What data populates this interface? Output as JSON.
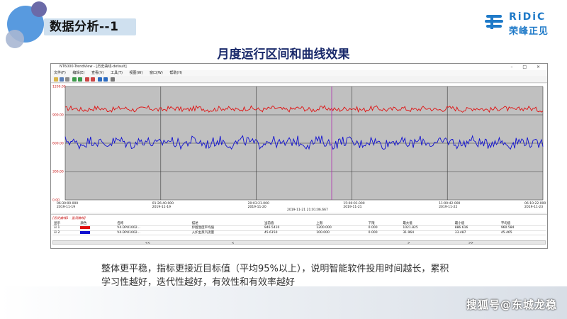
{
  "slide": {
    "section_title": "数据分析--1",
    "title": "月度运行区间和曲线效果",
    "caption_line1": "整体更平稳，指标更接近目标值（平均95%以上），说明智能软件投用时间越长，累积",
    "caption_line2": "学习性越好，迭代性越好，有效性和有效率越好",
    "watermark": "搜狐号@东城龙稳"
  },
  "logo": {
    "en": "RiDiC",
    "cn": "荣峰正见",
    "color": "#1f7ac8"
  },
  "window": {
    "title": "NT6000-TrendView - [历史曲线-default]",
    "menu": [
      "文件(F)",
      "编辑(E)",
      "查看(V)",
      "工具(T)",
      "视图(W)",
      "窗口(W)",
      "帮助(H)"
    ],
    "controls": "–  □  ×"
  },
  "chart_data": {
    "type": "line",
    "y_tick_labels": [
      "1200.00",
      "900.00",
      "600.00",
      "300.00",
      "0.00"
    ],
    "x_tick_labels": [
      [
        "06:30:00.000",
        "2019-11-19"
      ],
      [
        "01:26:40.000",
        "2019-11-19"
      ],
      [
        "20:03:21.000",
        "2019-11-20"
      ],
      [
        "15:00:01.000",
        "2019-11-21"
      ],
      [
        "11:00:42.000",
        "2019-11-22"
      ],
      [
        "06:10:22.000",
        "2019-11-23"
      ]
    ],
    "cursor_label": "2019-11-21 21:01:06.667",
    "ylim": [
      0,
      1200
    ],
    "grid": true,
    "series": [
      {
        "color": "#e01010",
        "mean": 962.3,
        "noise": 26
      },
      {
        "color": "#1010d0",
        "mean": 608.2,
        "noise": 55
      }
    ]
  },
  "legend": {
    "title": "[历史曲线1 - 监测曲线]",
    "headers": [
      "显示",
      "颜色",
      "名称",
      "描述",
      "当前值",
      "上限",
      "下限",
      "最大值",
      "最小值",
      "平均值"
    ],
    "rows": [
      {
        "check": "☑ 1",
        "color": "#e01010",
        "name": "V4.DPU1002...",
        "desc": "炉膛温度平均值",
        "current": "946.5410",
        "upper": "1200.000",
        "lower": "0.000",
        "max": "1021.825",
        "min": "886.616",
        "avg": "960.584"
      },
      {
        "check": "☑ 2",
        "color": "#1010d0",
        "name": "V4.DPU1002...",
        "desc": "入炉主蒸汽流量",
        "current": "45.6150",
        "upper": "100.000",
        "lower": "0.000",
        "max": "31.964",
        "min": "33.487",
        "avg": "45.465"
      }
    ],
    "nav": [
      "<<",
      "<",
      ">",
      ">>"
    ]
  }
}
